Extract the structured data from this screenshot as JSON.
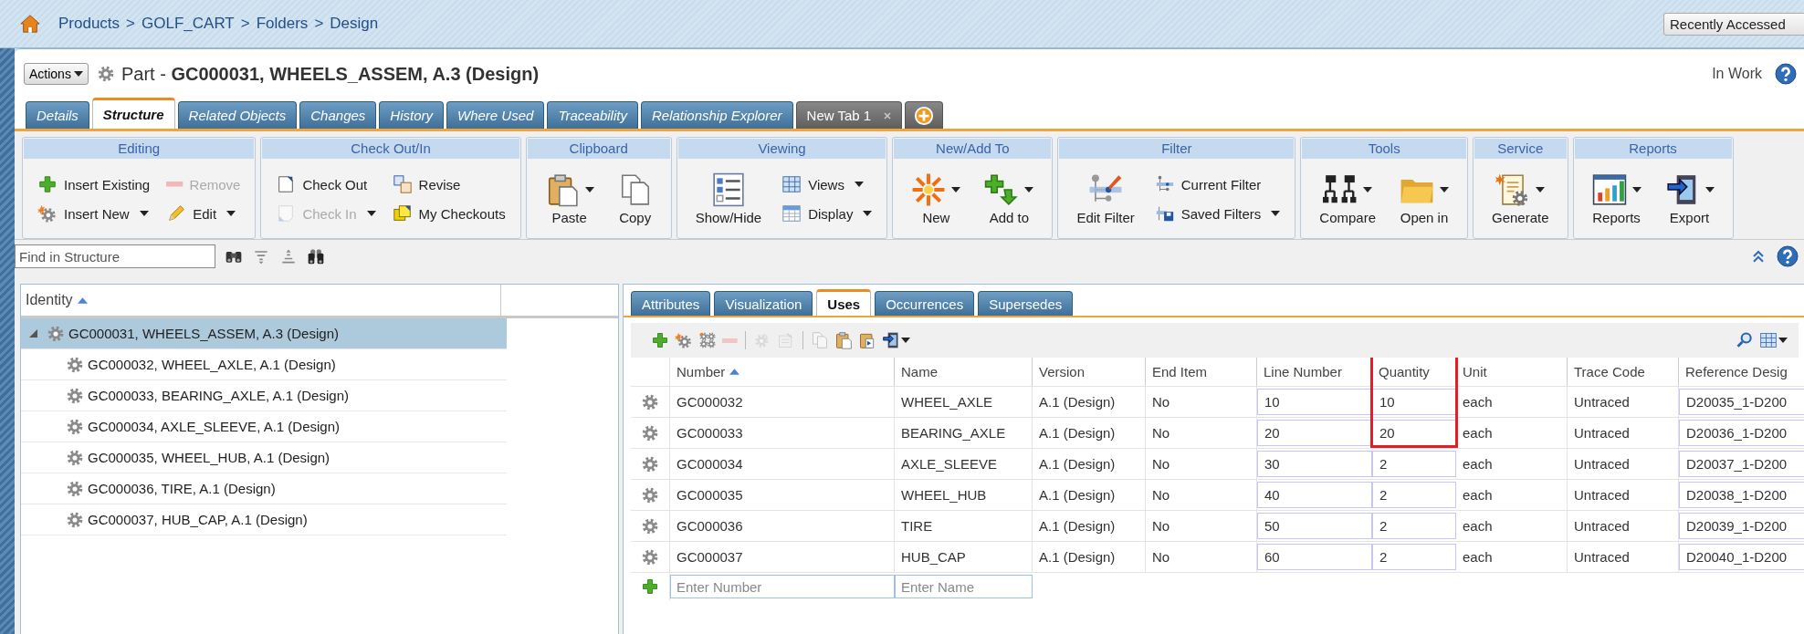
{
  "breadcrumb": {
    "items": [
      "Products",
      "GOLF_CART",
      "Folders",
      "Design"
    ],
    "separator": ">"
  },
  "recent_menu": {
    "value": "Recently Accessed"
  },
  "title": {
    "actions_button": "Actions",
    "text": "Part - **GC000031, WHEELS_ASSEM, A.3 (Design)**",
    "status": "In Work"
  },
  "tabs": [
    {
      "label": "Details",
      "selected": false,
      "kind": "standard"
    },
    {
      "label": "Structure",
      "selected": true,
      "kind": "standard"
    },
    {
      "label": "Related Objects",
      "selected": false,
      "kind": "standard"
    },
    {
      "label": "Changes",
      "selected": false,
      "kind": "standard"
    },
    {
      "label": "History",
      "selected": false,
      "kind": "standard"
    },
    {
      "label": "Where Used",
      "selected": false,
      "kind": "standard"
    },
    {
      "label": "Traceability",
      "selected": false,
      "kind": "standard"
    },
    {
      "label": "Relationship Explorer",
      "selected": false,
      "kind": "standard"
    },
    {
      "label": "New Tab 1",
      "selected": false,
      "kind": "custom"
    },
    {
      "selected": false,
      "kind": "add"
    }
  ],
  "ribbon": [
    {
      "title": "Editing",
      "columns": [
        [
          {
            "label": "Insert Existing",
            "kind": "small",
            "disabled": false,
            "dropdown": false
          },
          {
            "label": "Insert New",
            "kind": "small",
            "disabled": false,
            "dropdown": true
          }
        ],
        [
          {
            "label": "Remove",
            "kind": "small",
            "disabled": true,
            "dropdown": false
          },
          {
            "label": "Edit",
            "kind": "small",
            "disabled": false,
            "dropdown": true
          }
        ]
      ]
    },
    {
      "title": "Check Out/In",
      "columns": [
        [
          {
            "label": "Check Out",
            "kind": "small",
            "disabled": false,
            "dropdown": false
          },
          {
            "label": "Check In",
            "kind": "small",
            "disabled": true,
            "dropdown": true
          }
        ],
        [
          {
            "label": "Revise",
            "kind": "small",
            "disabled": false,
            "dropdown": false
          },
          {
            "label": "My Checkouts",
            "kind": "small",
            "disabled": false,
            "dropdown": false
          }
        ]
      ]
    },
    {
      "title": "Clipboard",
      "columns": [
        [
          {
            "label": "Paste",
            "kind": "large",
            "disabled": false,
            "dropdown": true
          }
        ],
        [
          {
            "label": "Copy",
            "kind": "large",
            "disabled": false,
            "dropdown": false
          }
        ]
      ]
    },
    {
      "title": "Viewing",
      "columns": [
        [
          {
            "label": "Show/Hide",
            "kind": "large",
            "disabled": false,
            "dropdown": false
          }
        ],
        [
          {
            "label": "Views",
            "kind": "small",
            "disabled": false,
            "dropdown": true
          },
          {
            "label": "Display",
            "kind": "small",
            "disabled": false,
            "dropdown": true
          }
        ]
      ]
    },
    {
      "title": "New/Add To",
      "columns": [
        [
          {
            "label": "New",
            "kind": "large",
            "disabled": false,
            "dropdown": true
          }
        ],
        [
          {
            "label": "Add to",
            "kind": "large",
            "disabled": false,
            "dropdown": true
          }
        ]
      ]
    },
    {
      "title": "Filter",
      "columns": [
        [
          {
            "label": "Edit Filter",
            "kind": "large",
            "disabled": false,
            "dropdown": false
          }
        ],
        [
          {
            "label": "Current Filter",
            "kind": "small",
            "disabled": false,
            "dropdown": false
          },
          {
            "label": "Saved Filters",
            "kind": "small",
            "disabled": false,
            "dropdown": true
          }
        ]
      ]
    },
    {
      "title": "Tools",
      "columns": [
        [
          {
            "label": "Compare",
            "kind": "large",
            "disabled": false,
            "dropdown": true
          }
        ],
        [
          {
            "label": "Open in",
            "kind": "large",
            "disabled": false,
            "dropdown": true
          }
        ]
      ]
    },
    {
      "title": "Service",
      "columns": [
        [
          {
            "label": "Generate",
            "kind": "large",
            "disabled": false,
            "dropdown": true
          }
        ]
      ]
    },
    {
      "title": "Reports",
      "columns": [
        [
          {
            "label": "Reports",
            "kind": "large",
            "disabled": false,
            "dropdown": true
          }
        ],
        [
          {
            "label": "Export",
            "kind": "large",
            "disabled": false,
            "dropdown": true
          }
        ]
      ]
    }
  ],
  "search": {
    "placeholder": "Find in Structure"
  },
  "structure": {
    "column": "Identity",
    "sorted": true,
    "tree": [
      {
        "label": "GC000031, WHEELS_ASSEM, A.3 (Design)",
        "expanded": true,
        "selected": true,
        "children": [
          {
            "label": "GC000032, WHEEL_AXLE, A.1 (Design)",
            "selected": false
          },
          {
            "label": "GC000033, BEARING_AXLE, A.1 (Design)",
            "selected": false
          },
          {
            "label": "GC000034, AXLE_SLEEVE, A.1 (Design)",
            "selected": false
          },
          {
            "label": "GC000035, WHEEL_HUB, A.1 (Design)",
            "selected": false
          },
          {
            "label": "GC000036, TIRE, A.1 (Design)",
            "selected": false
          },
          {
            "label": "GC000037, HUB_CAP, A.1 (Design)",
            "selected": false
          }
        ]
      }
    ]
  },
  "detail_tabs": [
    {
      "label": "Attributes",
      "selected": false
    },
    {
      "label": "Visualization",
      "selected": false
    },
    {
      "label": "Uses",
      "selected": true
    },
    {
      "label": "Occurrences",
      "selected": false
    },
    {
      "label": "Supersedes",
      "selected": false
    }
  ],
  "uses_toolbar": [
    [
      {
        "disabled": false,
        "dropdown": false
      },
      {
        "disabled": false,
        "dropdown": false
      },
      {
        "disabled": false,
        "dropdown": false
      },
      {
        "disabled": true,
        "dropdown": false
      }
    ],
    [
      {
        "disabled": true,
        "dropdown": false
      },
      {
        "disabled": true,
        "dropdown": false
      }
    ],
    [
      {
        "disabled": true,
        "dropdown": false
      },
      {
        "disabled": false,
        "dropdown": false
      },
      {
        "disabled": false,
        "dropdown": false
      },
      {
        "disabled": false,
        "dropdown": true
      }
    ]
  ],
  "uses_toolbar_right": [
    {
      "disabled": false,
      "dropdown": false
    },
    {
      "disabled": false,
      "dropdown": true
    }
  ],
  "uses_table": {
    "columns": [
      {
        "label": "Number",
        "sorted": true,
        "editable": false,
        "highlighted": false
      },
      {
        "label": "Name",
        "sorted": false,
        "editable": false,
        "highlighted": false
      },
      {
        "label": "Version",
        "sorted": false,
        "editable": false,
        "highlighted": false
      },
      {
        "label": "End Item",
        "sorted": false,
        "editable": false,
        "highlighted": false
      },
      {
        "label": "Line Number",
        "sorted": false,
        "editable": true,
        "highlighted": false
      },
      {
        "label": "Quantity",
        "sorted": false,
        "editable": true,
        "highlighted": true
      },
      {
        "label": "Unit",
        "sorted": false,
        "editable": false,
        "highlighted": false
      },
      {
        "label": "Trace Code",
        "sorted": false,
        "editable": false,
        "highlighted": false
      },
      {
        "label": "Reference Desig",
        "sorted": false,
        "editable": true,
        "highlighted": false
      }
    ],
    "rows": [
      {
        "highlighted": true,
        "cells": [
          "GC000032",
          "WHEEL_AXLE",
          "A.1 (Design)",
          "No",
          "10",
          "10",
          "each",
          "Untraced",
          "D20035_1-D200"
        ]
      },
      {
        "highlighted": true,
        "cells": [
          "GC000033",
          "BEARING_AXLE",
          "A.1 (Design)",
          "No",
          "20",
          "20",
          "each",
          "Untraced",
          "D20036_1-D200"
        ]
      },
      {
        "highlighted": false,
        "cells": [
          "GC000034",
          "AXLE_SLEEVE",
          "A.1 (Design)",
          "No",
          "30",
          "2",
          "each",
          "Untraced",
          "D20037_1-D200"
        ]
      },
      {
        "highlighted": false,
        "cells": [
          "GC000035",
          "WHEEL_HUB",
          "A.1 (Design)",
          "No",
          "40",
          "2",
          "each",
          "Untraced",
          "D20038_1-D200"
        ]
      },
      {
        "highlighted": false,
        "cells": [
          "GC000036",
          "TIRE",
          "A.1 (Design)",
          "No",
          "50",
          "2",
          "each",
          "Untraced",
          "D20039_1-D200"
        ]
      },
      {
        "highlighted": false,
        "cells": [
          "GC000037",
          "HUB_CAP",
          "A.1 (Design)",
          "No",
          "60",
          "2",
          "each",
          "Untraced",
          "D20040_1-D200"
        ]
      }
    ],
    "new_row": {
      "number_placeholder": "Enter Number",
      "name_placeholder": "Enter Name"
    }
  }
}
